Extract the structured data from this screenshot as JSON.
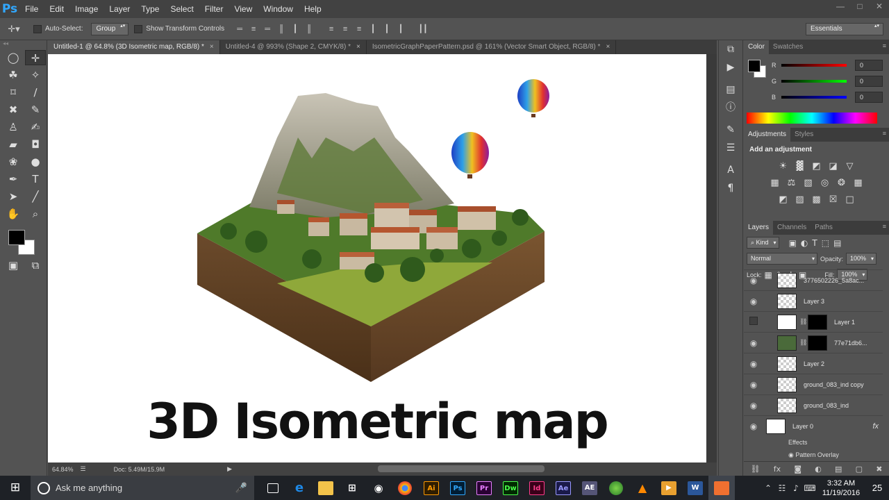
{
  "app": {
    "logo": "Ps"
  },
  "menu": [
    "File",
    "Edit",
    "Image",
    "Layer",
    "Type",
    "Select",
    "Filter",
    "View",
    "Window",
    "Help"
  ],
  "window_controls": [
    "—",
    "□",
    "✕"
  ],
  "options": {
    "auto_select_label": "Auto-Select:",
    "auto_select_value": "Group",
    "transform_label": "Show Transform Controls",
    "workspace": "Essentials"
  },
  "tabs": [
    {
      "label": "Untitled-1 @ 64.8% (3D Isometric map, RGB/8) *",
      "active": true
    },
    {
      "label": "Untitled-4 @ 993% (Shape 2, CMYK/8) *",
      "active": false
    },
    {
      "label": "IsometricGraphPaperPattern.psd @ 161% (Vector Smart Object, RGB/8) *",
      "active": false
    }
  ],
  "tab_close": "×",
  "canvas": {
    "title_text": "3D Isometric map"
  },
  "status": {
    "zoom": "64.84%",
    "doc": "Doc: 5.49M/15.9M",
    "arrow": "▶"
  },
  "panels": {
    "color": {
      "tabs": [
        "Color",
        "Swatches"
      ],
      "r_label": "R",
      "g_label": "G",
      "b_label": "B",
      "r_value": "0",
      "g_value": "0",
      "b_value": "0"
    },
    "adjustments": {
      "tabs": [
        "Adjustments",
        "Styles"
      ],
      "title": "Add an adjustment"
    },
    "layers": {
      "tabs": [
        "Layers",
        "Channels",
        "Paths"
      ],
      "filter_kind": "⌕ Kind",
      "blend_mode": "Normal",
      "opacity_label": "Opacity:",
      "opacity_value": "100%",
      "lock_label": "Lock:",
      "fill_label": "Fill:",
      "fill_value": "100%",
      "items": [
        {
          "name": "3776502226_5a8ac...",
          "visible": true
        },
        {
          "name": "Layer 3",
          "visible": true
        },
        {
          "name": "Layer 1",
          "visible": false
        },
        {
          "name": "77e71db6...",
          "visible": true
        },
        {
          "name": "Layer 2",
          "visible": true
        },
        {
          "name": "ground_083_ind copy",
          "visible": true
        },
        {
          "name": "ground_083_ind",
          "visible": true
        },
        {
          "name": "Layer 0",
          "visible": true
        }
      ],
      "effects_label": "Effects",
      "pattern_overlay_label": "Pattern Overlay",
      "fx_label": "fx"
    }
  },
  "taskbar": {
    "search_placeholder": "Ask me anything",
    "time": "3:32 AM",
    "date": "11/19/2016",
    "notification_count": "25",
    "apps": [
      {
        "label": "Ai",
        "color": "#ff9a00",
        "bg": "#2f1d00"
      },
      {
        "label": "Ps",
        "color": "#31a8ff",
        "bg": "#001d34"
      },
      {
        "label": "Pr",
        "color": "#e77fff",
        "bg": "#2a0034"
      },
      {
        "label": "Dw",
        "color": "#4bff4b",
        "bg": "#002a00"
      },
      {
        "label": "Id",
        "color": "#ff3d8b",
        "bg": "#3a0019"
      },
      {
        "label": "Ae",
        "color": "#9999ff",
        "bg": "#1a1a4a"
      },
      {
        "label": "AE",
        "color": "#ffffff",
        "bg": "#555577"
      }
    ]
  },
  "colors": {
    "accent": "#31a8ff",
    "canvas_bg": "#ffffff",
    "ui_dark": "#424242"
  }
}
